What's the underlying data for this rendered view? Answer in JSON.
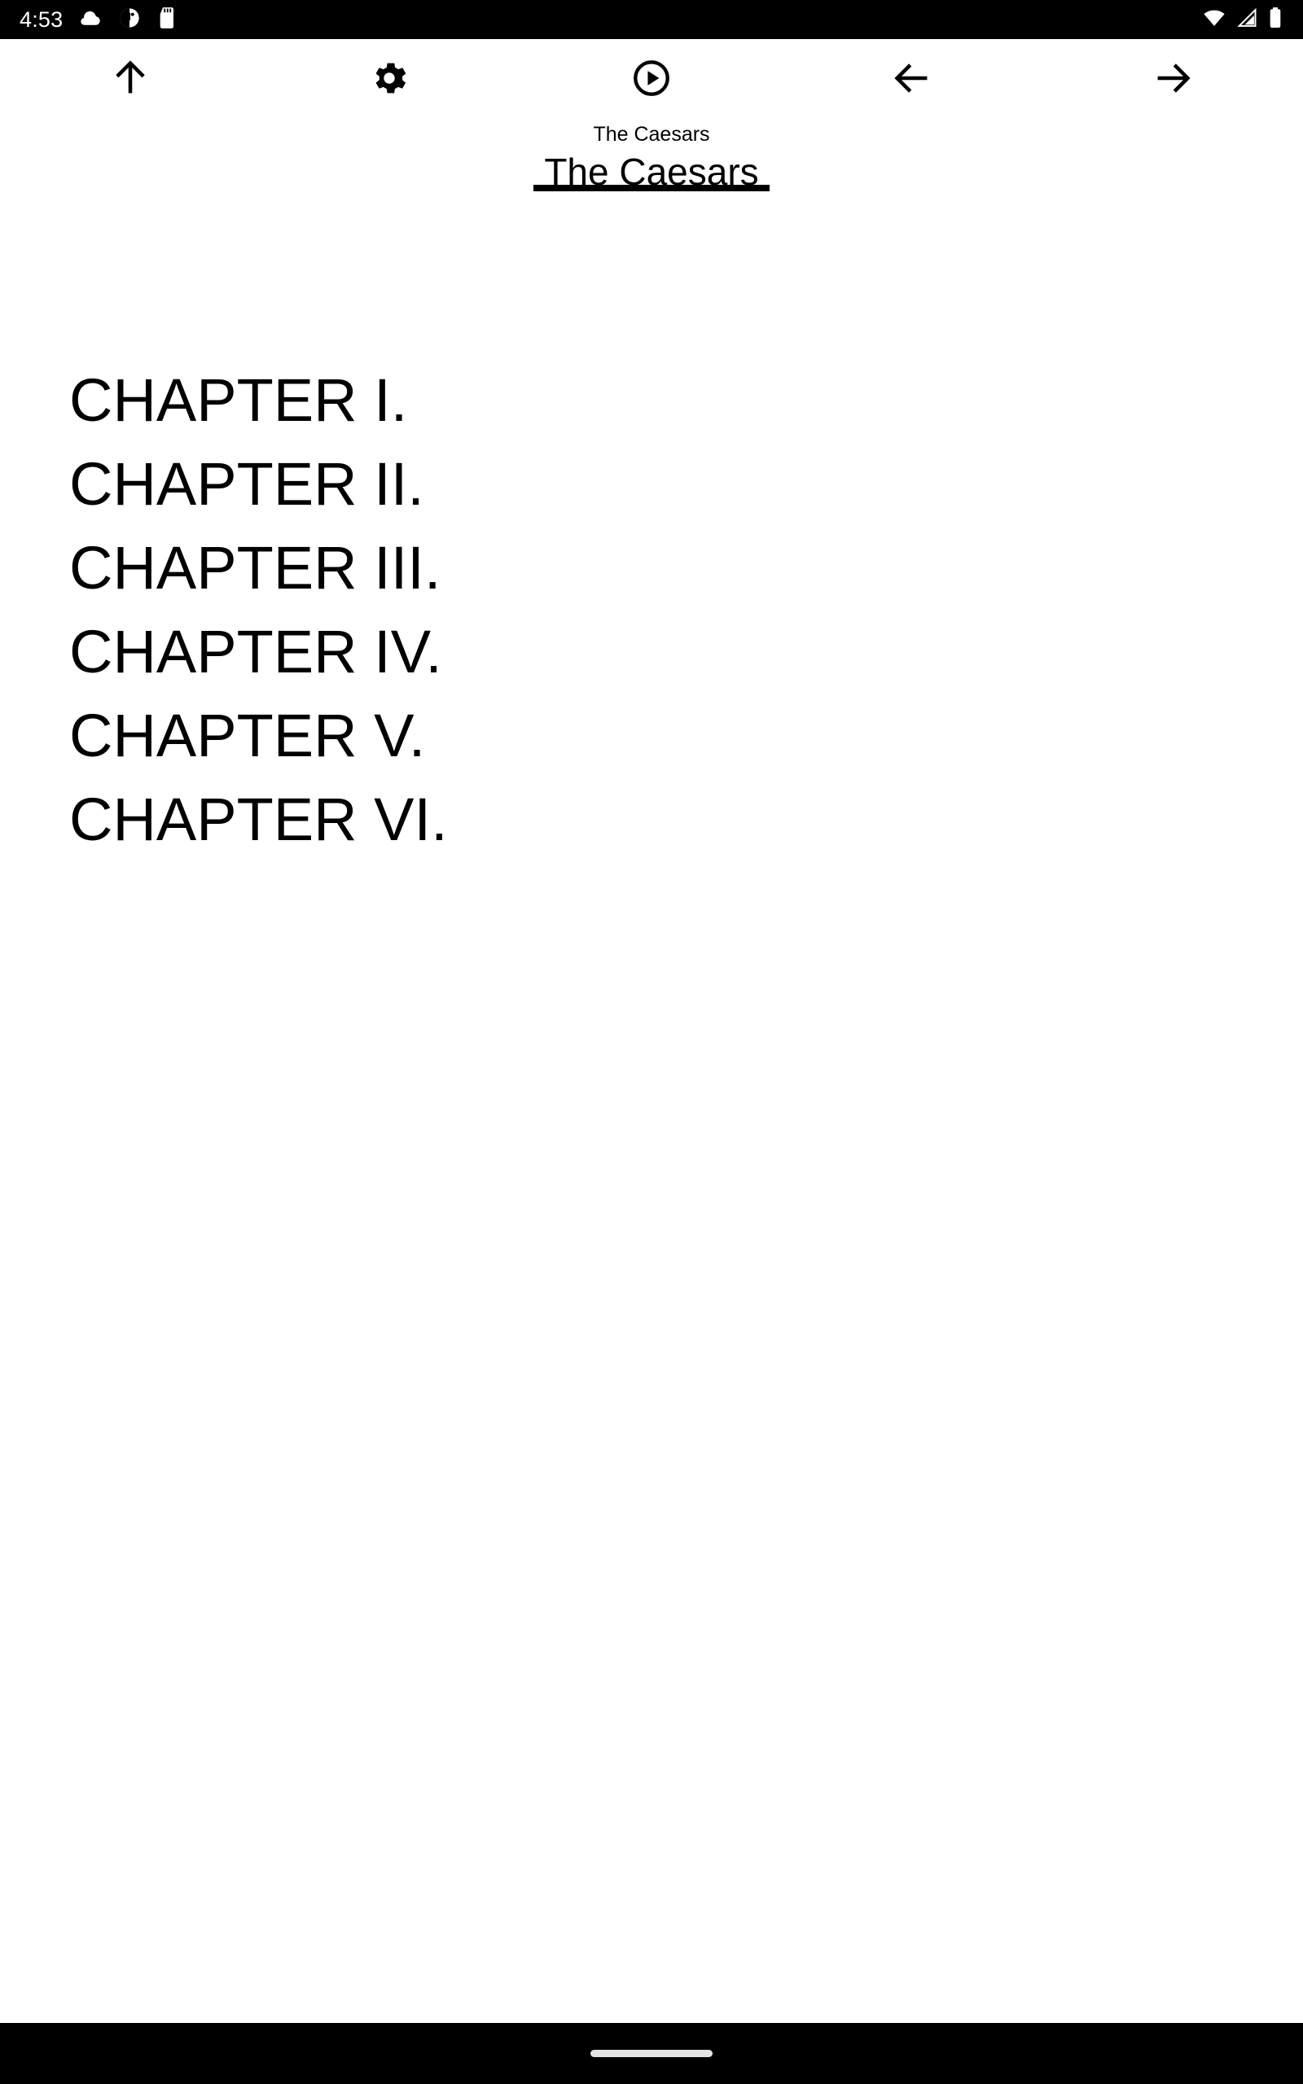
{
  "status_bar": {
    "clock": "4:53",
    "left_icons": [
      "cloud-icon",
      "circle-half-icon",
      "sd-card-icon"
    ],
    "right_icons": [
      "wifi-icon",
      "cellular-signal-icon",
      "battery-icon"
    ],
    "background_color": "#000000",
    "foreground_color": "#ffffff"
  },
  "toolbar": {
    "buttons": [
      {
        "name": "scroll-to-top-button",
        "icon": "arrow-up-icon",
        "label": "Scroll to top"
      },
      {
        "name": "settings-button",
        "icon": "gear-icon",
        "label": "Settings"
      },
      {
        "name": "play-button",
        "icon": "play-circle-icon",
        "label": "Play"
      },
      {
        "name": "previous-button",
        "icon": "arrow-left-icon",
        "label": "Previous"
      },
      {
        "name": "next-button",
        "icon": "arrow-right-icon",
        "label": "Next"
      }
    ]
  },
  "header": {
    "book_label": "The Caesars",
    "book_title": "The Caesars"
  },
  "main": {
    "chapters": [
      {
        "label": "CHAPTER I."
      },
      {
        "label": "CHAPTER II."
      },
      {
        "label": "CHAPTER III."
      },
      {
        "label": "CHAPTER IV."
      },
      {
        "label": "CHAPTER V."
      },
      {
        "label": "CHAPTER VI."
      }
    ]
  },
  "nav_bar": {
    "gesture_pill": "home-gesture-pill",
    "background_color": "#000000",
    "pill_color": "#e3e3e3"
  },
  "theme": {
    "page_background": "#ffffff",
    "text_color": "#000000",
    "accent": "#000000"
  }
}
